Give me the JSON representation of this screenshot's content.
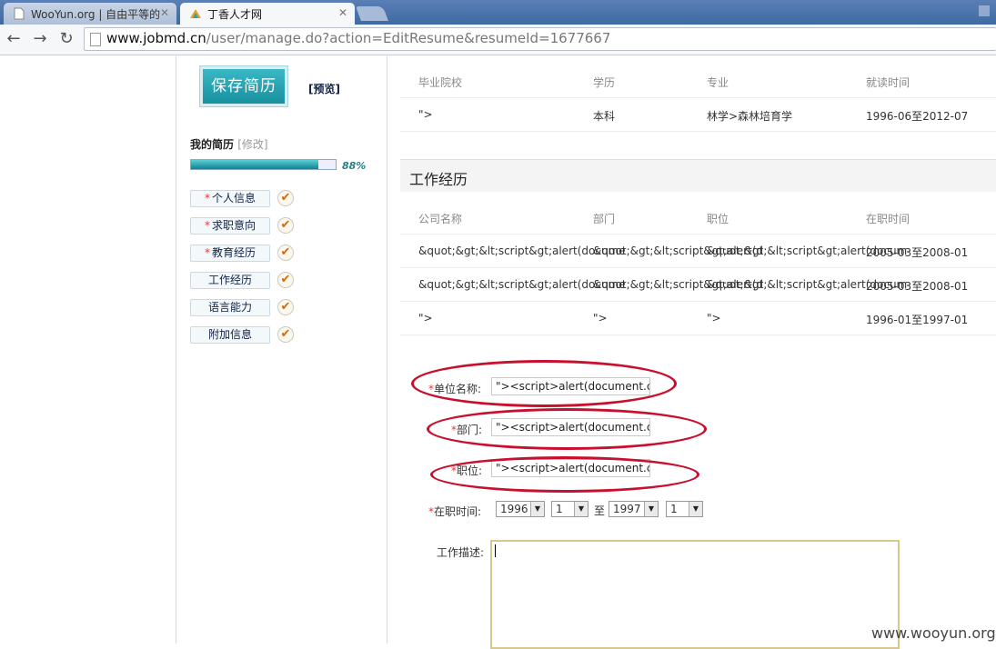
{
  "browser": {
    "tabs": [
      {
        "title": "WooYun.org | 自由平等的",
        "active": false
      },
      {
        "title": "丁香人才网",
        "active": true
      }
    ],
    "url_host": "www.jobmd.cn",
    "url_path": "/user/manage.do?action=EditResume&resumeId=1677667"
  },
  "sidebar": {
    "save_label": "保存简历",
    "preview_label": "[预览]",
    "my_resume_label": "我的简历",
    "modify_label": "[修改]",
    "progress_percent": 88,
    "progress_text": "88%",
    "items": [
      {
        "label": "个人信息",
        "required": true,
        "star": "*"
      },
      {
        "label": "求职意向",
        "required": true,
        "star": "*"
      },
      {
        "label": "教育经历",
        "required": true,
        "star": "*"
      },
      {
        "label": "工作经历",
        "required": false,
        "star": ""
      },
      {
        "label": "语言能力",
        "required": false,
        "star": ""
      },
      {
        "label": "附加信息",
        "required": false,
        "star": ""
      }
    ],
    "check_glyph": "✔"
  },
  "education": {
    "headers": [
      "毕业院校",
      "学历",
      "专业",
      "就读时间"
    ],
    "rows": [
      [
        "\">",
        "本科",
        "林学>森林培育学",
        "1996-06至2012-07"
      ]
    ]
  },
  "work": {
    "section_title": "工作经历",
    "headers": [
      "公司名称",
      "部门",
      "职位",
      "在职时间"
    ],
    "rows": [
      [
        "&quot;&gt;&lt;script&gt;alert(docume",
        "&quot;&gt;&lt;script&gt;alert(d",
        "&quot;&gt;&lt;script&gt;alert(docum",
        "2005-03至2008-01"
      ],
      [
        "&quot;&gt;&lt;script&gt;alert(docume",
        "&quot;&gt;&lt;script&gt;alert(d",
        "&quot;&gt;&lt;script&gt;alert(docum",
        "2005-03至2008-01"
      ],
      [
        "\">",
        "\">",
        "\">",
        "1996-01至1997-01"
      ]
    ]
  },
  "form": {
    "company_label": "单位名称:",
    "company_value": "\"><script>alert(document.cooki",
    "dept_label": "部门:",
    "dept_value": "\"><script>alert(document.cooki",
    "position_label": "职位:",
    "position_value": "\"><script>alert(document.cooki",
    "period_label": "在职时间:",
    "start_year": "1996",
    "start_month": "1",
    "to_label": "至",
    "end_year": "1997",
    "end_month": "1",
    "desc_label": "工作描述:",
    "required_star": "*",
    "select_arrow": "▼"
  },
  "watermark": "www.wooyun.org",
  "colors": {
    "annotation_oval": "#c8102e",
    "accent": "#1890a0",
    "check": "#d26a07"
  }
}
